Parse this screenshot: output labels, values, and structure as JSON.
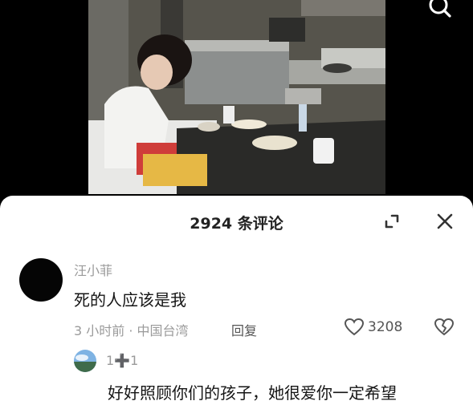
{
  "comments_sheet": {
    "title": "2924 条评论"
  },
  "comment": {
    "username": "汪小菲",
    "text": "死的人应该是我",
    "meta": "3 小时前 · 中国台湾",
    "reply_label": "回复",
    "like_count": "3208"
  },
  "reply": {
    "username": "1➕1",
    "text": "好好照顾你们的孩子，她很爱你一定希望"
  },
  "icons": {
    "search": "search-icon",
    "expand": "expand-icon",
    "close": "close-icon",
    "like": "heart-outline-icon",
    "dislike": "broken-heart-icon"
  },
  "colors": {
    "sheet_bg": "#ffffff",
    "primary_text": "#151515",
    "secondary_text": "#9a9a9a"
  }
}
